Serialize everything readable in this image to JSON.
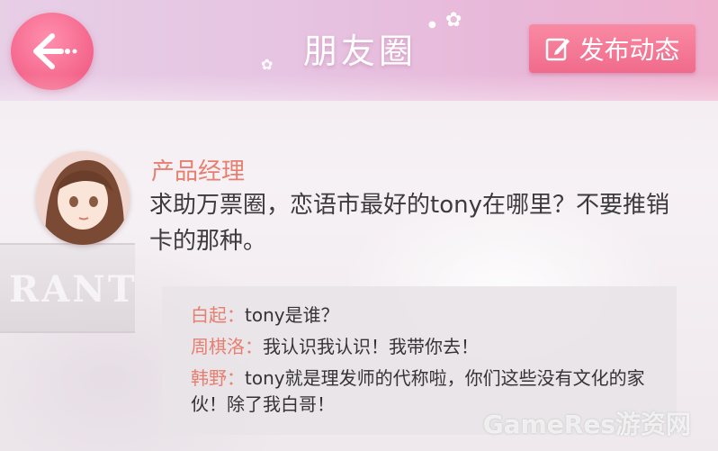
{
  "header": {
    "title": "朋友圈",
    "post_button_label": "发布动态"
  },
  "post": {
    "author": "产品经理",
    "text": "求助万票圈，恋语市最好的tony在哪里？不要推销卡的那种。"
  },
  "comments": [
    {
      "name": "白起：",
      "text": "tony是谁？"
    },
    {
      "name": "周棋洛：",
      "text": "我认识我认识！我带你去！"
    },
    {
      "name": "韩野：",
      "text": "tony就是理发师的代称啦，你们这些没有文化的家伙！除了我白哥！"
    }
  ],
  "background_sign_text": "RANT",
  "watermark": "GameRes游资网",
  "colors": {
    "accent": "#f06b8b",
    "name_color": "#e77f70"
  }
}
